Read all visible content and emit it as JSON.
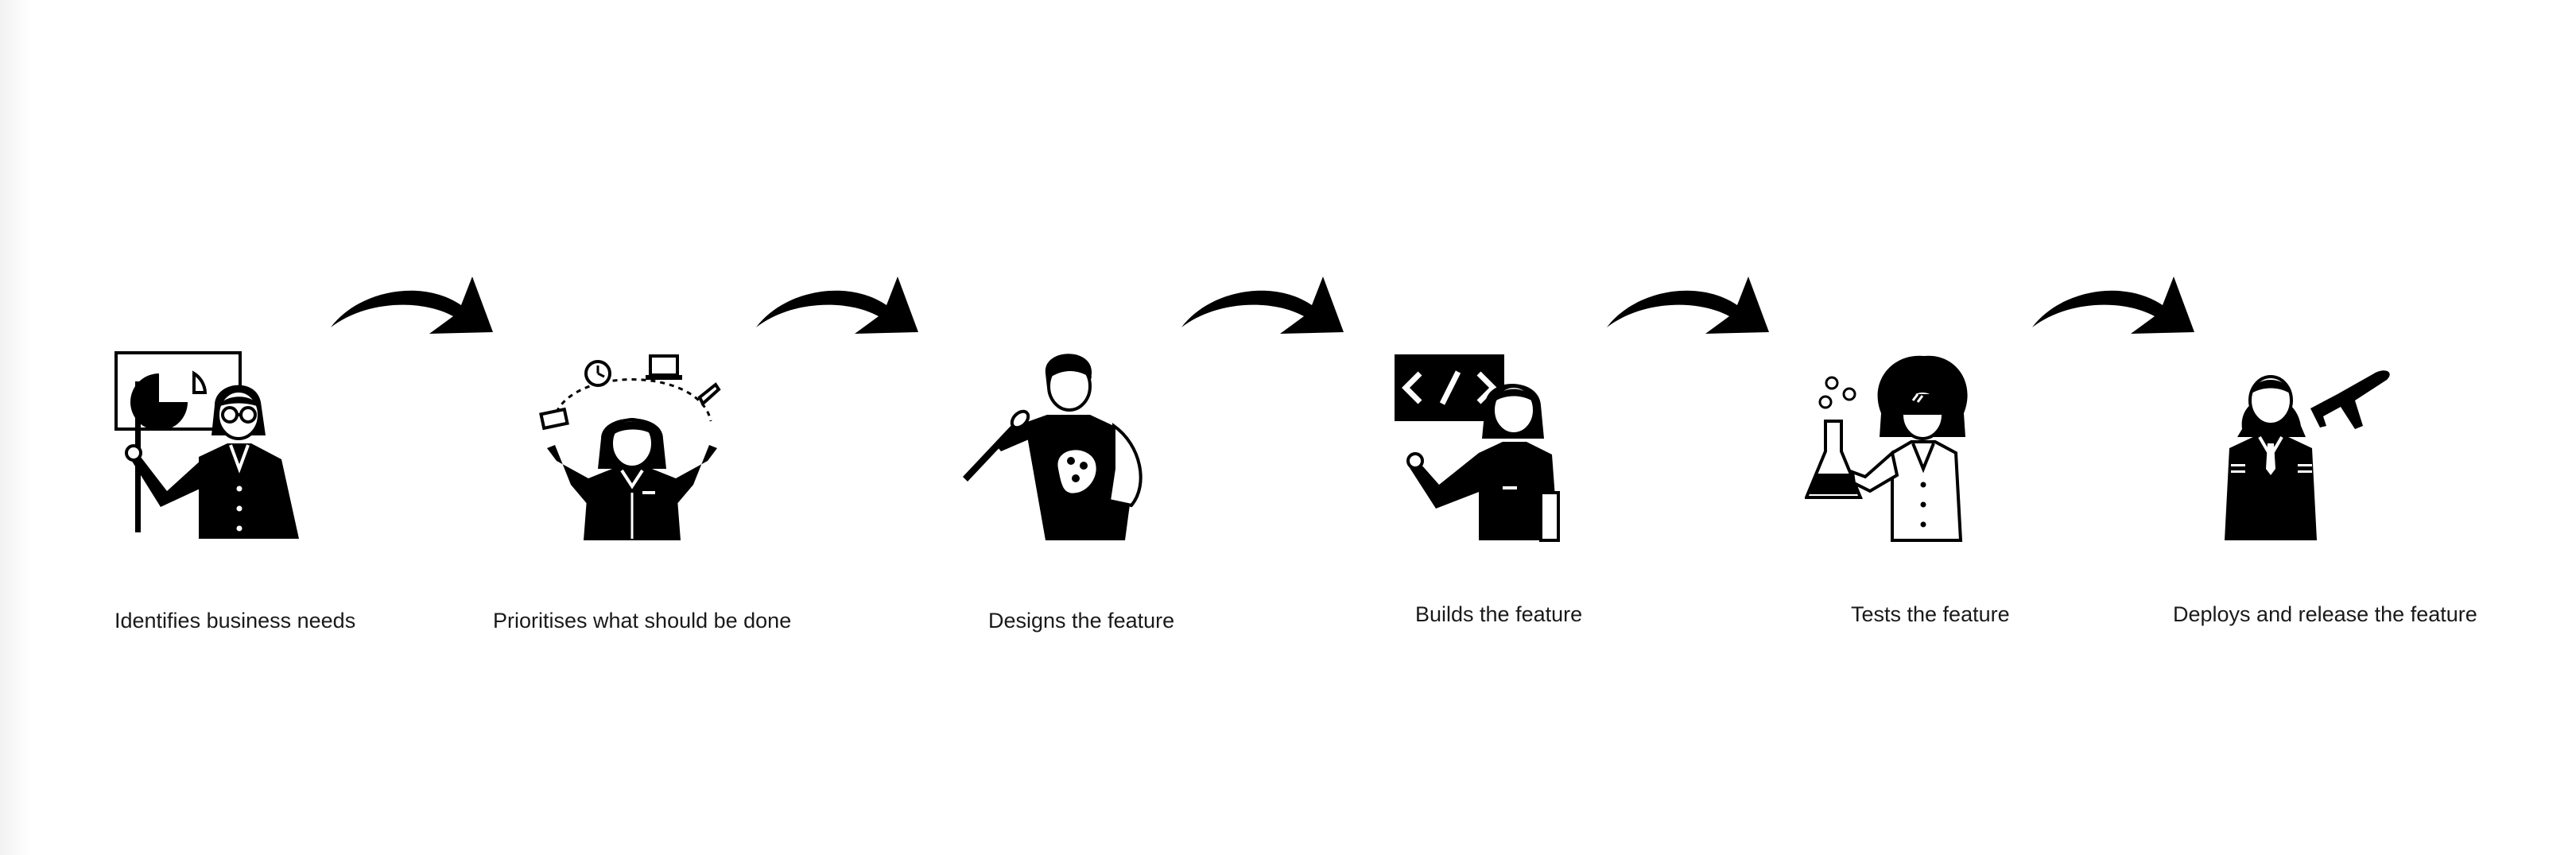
{
  "steps": [
    {
      "label": "Identifies business needs",
      "icon": "presenter-chart-icon"
    },
    {
      "label": "Prioritises what should be done",
      "icon": "prioritiser-juggling-icon"
    },
    {
      "label": "Designs the feature",
      "icon": "designer-palette-icon"
    },
    {
      "label": "Builds the feature",
      "icon": "developer-code-icon"
    },
    {
      "label": "Tests the feature",
      "icon": "tester-flask-icon"
    },
    {
      "label": "Deploys and release the feature",
      "icon": "pilot-airplane-icon"
    }
  ],
  "colors": {
    "ink": "#000000",
    "text": "#1a1a1a",
    "background": "#ffffff"
  }
}
